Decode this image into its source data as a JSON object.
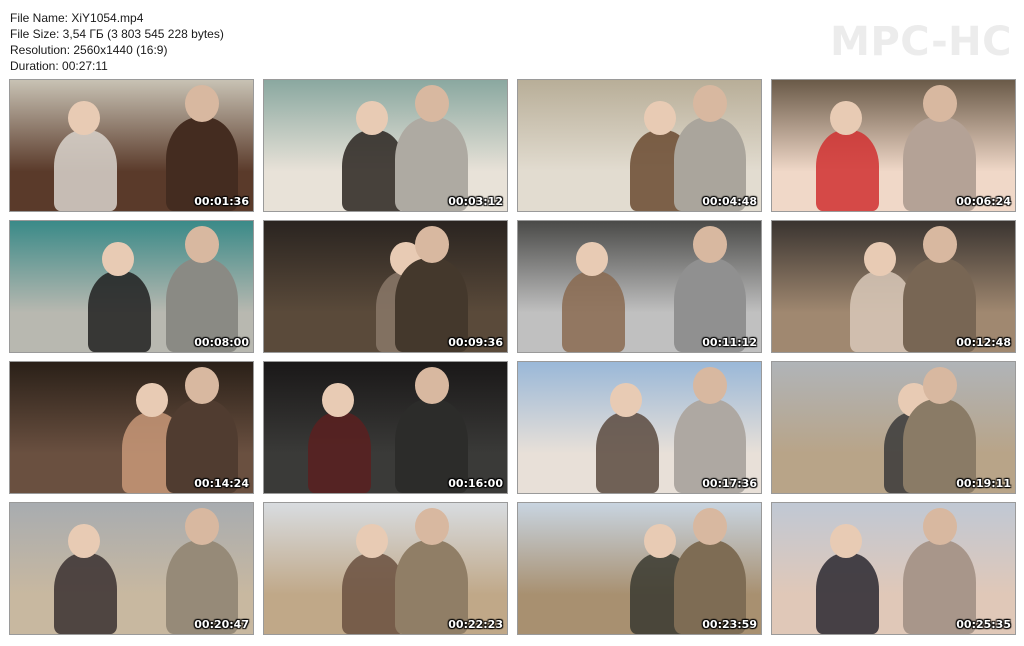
{
  "file_info": {
    "name_line": "File Name: XiY1054.mp4",
    "size_line": "File Size: 3,54 ГБ (3 803 545 228 bytes)",
    "resolution_line": "Resolution: 2560x1440 (16:9)",
    "duration_line": "Duration: 00:27:11"
  },
  "brand": "MPC-HC",
  "thumbnails": [
    {
      "time": "00:01:36",
      "palette": [
        "#c8c2b4",
        "#5a3a2a",
        "#d9d4cc"
      ]
    },
    {
      "time": "00:03:12",
      "palette": [
        "#8aa8a0",
        "#e8e2d8",
        "#2a2420"
      ]
    },
    {
      "time": "00:04:48",
      "palette": [
        "#b8ae98",
        "#e2dcd0",
        "#6a4a30"
      ]
    },
    {
      "time": "00:06:24",
      "palette": [
        "#6a5a48",
        "#f0d8c8",
        "#d03030"
      ]
    },
    {
      "time": "00:08:00",
      "palette": [
        "#3a8a88",
        "#b8b8b0",
        "#202020"
      ]
    },
    {
      "time": "00:09:36",
      "palette": [
        "#2a2420",
        "#5a4a3a",
        "#8a7868"
      ]
    },
    {
      "time": "00:11:12",
      "palette": [
        "#4a4a48",
        "#c0c0c0",
        "#8a6a50"
      ]
    },
    {
      "time": "00:12:48",
      "palette": [
        "#3a3430",
        "#a08870",
        "#d8c8b8"
      ]
    },
    {
      "time": "00:14:24",
      "palette": [
        "#2a2018",
        "#6a5040",
        "#c89878"
      ]
    },
    {
      "time": "00:16:00",
      "palette": [
        "#1a1818",
        "#3a3a38",
        "#5a2020"
      ]
    },
    {
      "time": "00:17:36",
      "palette": [
        "#9ab8d8",
        "#e8e0d8",
        "#5a4a40"
      ]
    },
    {
      "time": "00:19:11",
      "palette": [
        "#b0b4b8",
        "#b8a488",
        "#3a3a3a"
      ]
    },
    {
      "time": "00:20:47",
      "palette": [
        "#a8acb0",
        "#c8b8a0",
        "#3a3030"
      ]
    },
    {
      "time": "00:22:23",
      "palette": [
        "#d8dce0",
        "#c0a888",
        "#6a5040"
      ]
    },
    {
      "time": "00:23:59",
      "palette": [
        "#c8d4e0",
        "#a89070",
        "#3a3a30"
      ]
    },
    {
      "time": "00:25:35",
      "palette": [
        "#c0c8d4",
        "#e0c8b8",
        "#2a2830"
      ]
    }
  ]
}
